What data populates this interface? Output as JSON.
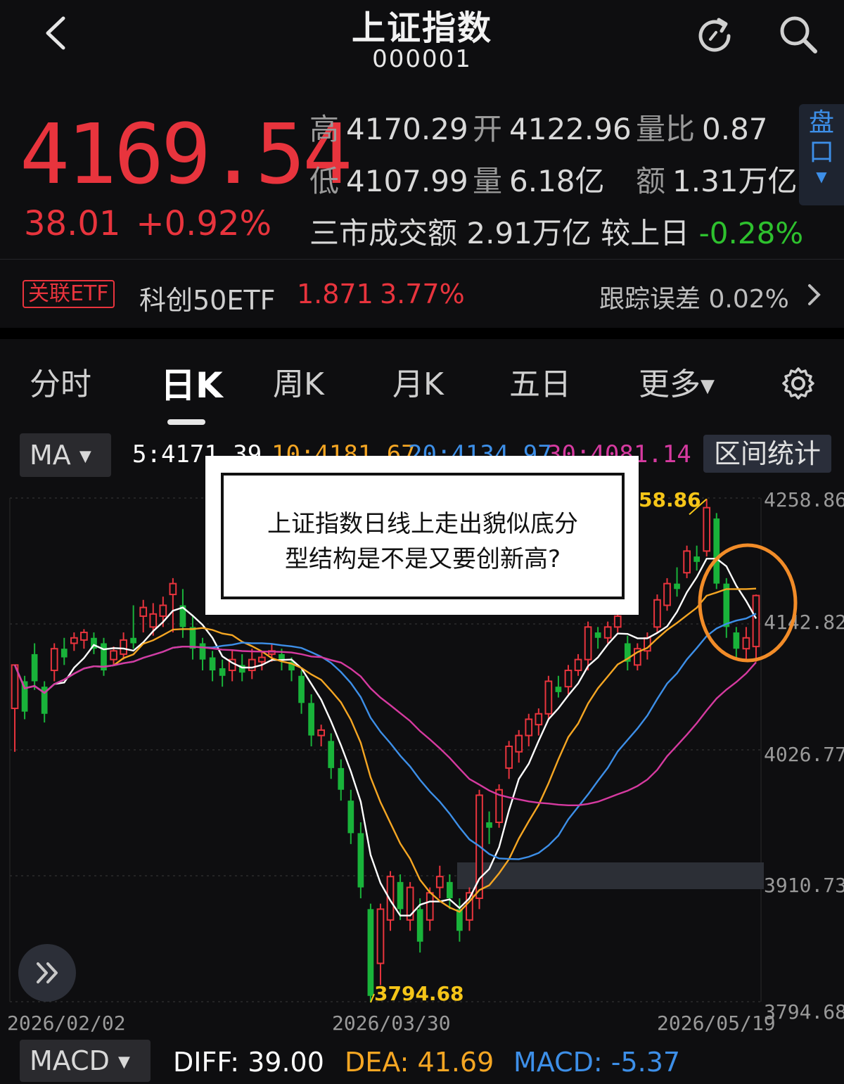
{
  "header": {
    "title": "上证指数",
    "code": "000001"
  },
  "quote": {
    "price": "4169.54",
    "change": "38.01",
    "change_pct": "+0.92%",
    "high_label": "高",
    "high": "4170.29",
    "open_label": "开",
    "open": "4122.96",
    "vol_ratio_label": "量比",
    "vol_ratio": "0.87",
    "low_label": "低",
    "low": "4107.99",
    "volume_label": "量",
    "volume": "6.18亿",
    "amount_label": "额",
    "amount": "1.31万亿",
    "market_turnover_label": "三市成交额",
    "market_turnover": "2.91万亿",
    "vs_prev_label": "较上日",
    "vs_prev": "-0.28%"
  },
  "pankou_label": "盘口",
  "etf": {
    "tag": "关联ETF",
    "name": "科创50ETF",
    "price": "1.871",
    "pct": "3.77%",
    "tracking_label": "跟踪误差",
    "tracking_value": "0.02%"
  },
  "tabs": [
    "分时",
    "日K",
    "周K",
    "月K",
    "五日",
    "更多"
  ],
  "ma": {
    "button": "MA",
    "ma5": "5:4171.39",
    "ma10": "10:4181.67",
    "ma20": "20:4134.97",
    "ma30": "30:4081.14",
    "interval_button": "区间统计"
  },
  "colors": {
    "up": "#e8343d",
    "down": "#19b33a",
    "ma5": "#ffffff",
    "ma10": "#f5a623",
    "ma20": "#3d8fe8",
    "ma30": "#d63aa0",
    "accent": "#3d8fe8"
  },
  "popup": {
    "line1": "上证指数日线上走出貌似底分",
    "line2": "型结构是不是又要创新高?"
  },
  "chart_data": {
    "type": "candlestick",
    "y_ticks": [
      "4258.86",
      "4142.82",
      "4026.77",
      "3910.73",
      "3794.68"
    ],
    "ylim": [
      3794.68,
      4258.86
    ],
    "x_ticks": [
      "2026/02/02",
      "2026/03/30",
      "2026/05/19"
    ],
    "annotations": {
      "high": "4258.86",
      "low": "3794.68"
    },
    "ohlc_note": "daily candles, open/close/high/low in index points",
    "candles": [
      [
        4065,
        4105,
        4025,
        4105
      ],
      [
        4090,
        4062,
        4055,
        4095
      ],
      [
        4115,
        4090,
        4082,
        4125
      ],
      [
        4085,
        4060,
        4052,
        4090
      ],
      [
        4100,
        4120,
        4090,
        4125
      ],
      [
        4120,
        4112,
        4105,
        4130
      ],
      [
        4125,
        4130,
        4118,
        4135
      ],
      [
        4128,
        4135,
        4120,
        4138
      ],
      [
        4130,
        4120,
        4115,
        4135
      ],
      [
        4125,
        4100,
        4095,
        4130
      ],
      [
        4110,
        4118,
        4105,
        4122
      ],
      [
        4115,
        4128,
        4110,
        4135
      ],
      [
        4130,
        4125,
        4120,
        4160
      ],
      [
        4150,
        4158,
        4135,
        4165
      ],
      [
        4140,
        4152,
        4132,
        4162
      ],
      [
        4150,
        4160,
        4140,
        4168
      ],
      [
        4170,
        4180,
        4135,
        4185
      ],
      [
        4160,
        4140,
        4130,
        4175
      ],
      [
        4140,
        4120,
        4110,
        4150
      ],
      [
        4125,
        4110,
        4100,
        4130
      ],
      [
        4112,
        4100,
        4090,
        4118
      ],
      [
        4102,
        4095,
        4085,
        4110
      ],
      [
        4100,
        4110,
        4090,
        4118
      ],
      [
        4105,
        4098,
        4090,
        4115
      ],
      [
        4100,
        4110,
        4092,
        4120
      ],
      [
        4108,
        4112,
        4100,
        4118
      ],
      [
        4115,
        4118,
        4108,
        4125
      ],
      [
        4115,
        4110,
        4100,
        4120
      ],
      [
        4108,
        4100,
        4090,
        4112
      ],
      [
        4095,
        4070,
        4060,
        4100
      ],
      [
        4070,
        4040,
        4030,
        4078
      ],
      [
        4040,
        4045,
        4030,
        4050
      ],
      [
        4035,
        4010,
        4000,
        4042
      ],
      [
        4010,
        3990,
        3980,
        4018
      ],
      [
        3980,
        3950,
        3940,
        3990
      ],
      [
        3950,
        3900,
        3890,
        3960
      ],
      [
        3880,
        3800,
        3794,
        3885
      ],
      [
        3830,
        3880,
        3810,
        3885
      ],
      [
        3870,
        3910,
        3860,
        3915
      ],
      [
        3905,
        3880,
        3870,
        3912
      ],
      [
        3870,
        3900,
        3860,
        3905
      ],
      [
        3880,
        3850,
        3840,
        3890
      ],
      [
        3870,
        3895,
        3860,
        3900
      ],
      [
        3900,
        3910,
        3890,
        3920
      ],
      [
        3905,
        3890,
        3880,
        3912
      ],
      [
        3880,
        3860,
        3850,
        3890
      ],
      [
        3870,
        3895,
        3860,
        3900
      ],
      [
        3890,
        3985,
        3880,
        3990
      ],
      [
        3960,
        3955,
        3940,
        3970
      ],
      [
        3960,
        3990,
        3955,
        3995
      ],
      [
        4010,
        4030,
        4000,
        4035
      ],
      [
        4025,
        4040,
        4015,
        4045
      ],
      [
        4040,
        4055,
        4030,
        4060
      ],
      [
        4050,
        4060,
        4040,
        4065
      ],
      [
        4060,
        4090,
        4055,
        4095
      ],
      [
        4085,
        4080,
        4075,
        4095
      ],
      [
        4085,
        4100,
        4078,
        4105
      ],
      [
        4100,
        4110,
        4095,
        4115
      ],
      [
        4110,
        4140,
        4100,
        4145
      ],
      [
        4135,
        4130,
        4120,
        4140
      ],
      [
        4130,
        4140,
        4125,
        4145
      ],
      [
        4140,
        4150,
        4135,
        4155
      ],
      [
        4125,
        4108,
        4100,
        4132
      ],
      [
        4105,
        4120,
        4100,
        4125
      ],
      [
        4118,
        4130,
        4110,
        4135
      ],
      [
        4140,
        4165,
        4135,
        4170
      ],
      [
        4160,
        4180,
        4155,
        4185
      ],
      [
        4180,
        4175,
        4168,
        4195
      ],
      [
        4190,
        4210,
        4185,
        4215
      ],
      [
        4205,
        4200,
        4192,
        4215
      ],
      [
        4210,
        4250,
        4205,
        4258
      ],
      [
        4240,
        4180,
        4175,
        4245
      ],
      [
        4180,
        4140,
        4130,
        4185
      ],
      [
        4135,
        4120,
        4110,
        4140
      ],
      [
        4120,
        4130,
        4108,
        4140
      ],
      [
        4122,
        4169,
        4108,
        4170
      ]
    ]
  },
  "macd": {
    "button": "MACD",
    "diff": "DIFF: 39.00",
    "dea": "DEA: 41.69",
    "macd": "MACD: -5.37"
  }
}
